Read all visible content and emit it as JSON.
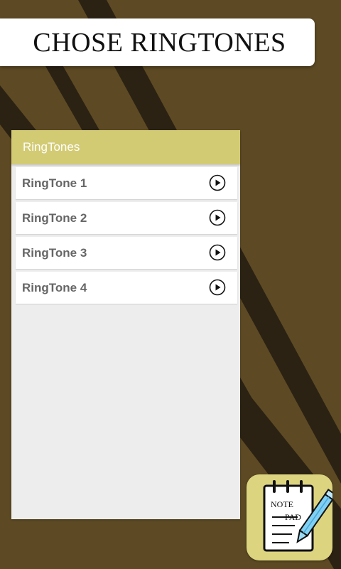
{
  "header": {
    "title": "CHOSE RINGTONES"
  },
  "panel": {
    "title": "RingTones",
    "items": [
      {
        "label": "RingTone 1",
        "action_icon": "play-icon"
      },
      {
        "label": "RingTone 2",
        "action_icon": "play-icon"
      },
      {
        "label": "RingTone 3",
        "action_icon": "play-icon"
      },
      {
        "label": "RingTone 4",
        "action_icon": "play-icon"
      }
    ]
  },
  "app_icon": {
    "line1": "NOTE",
    "line2": "PAD",
    "icon": "notepad-icon"
  },
  "colors": {
    "background": "#5d4a24",
    "stripes": "#2b2213",
    "panel_header": "#d3cb74",
    "list_background": "#ededed",
    "item_text": "#666666",
    "app_icon_bg": "#ddd480"
  }
}
